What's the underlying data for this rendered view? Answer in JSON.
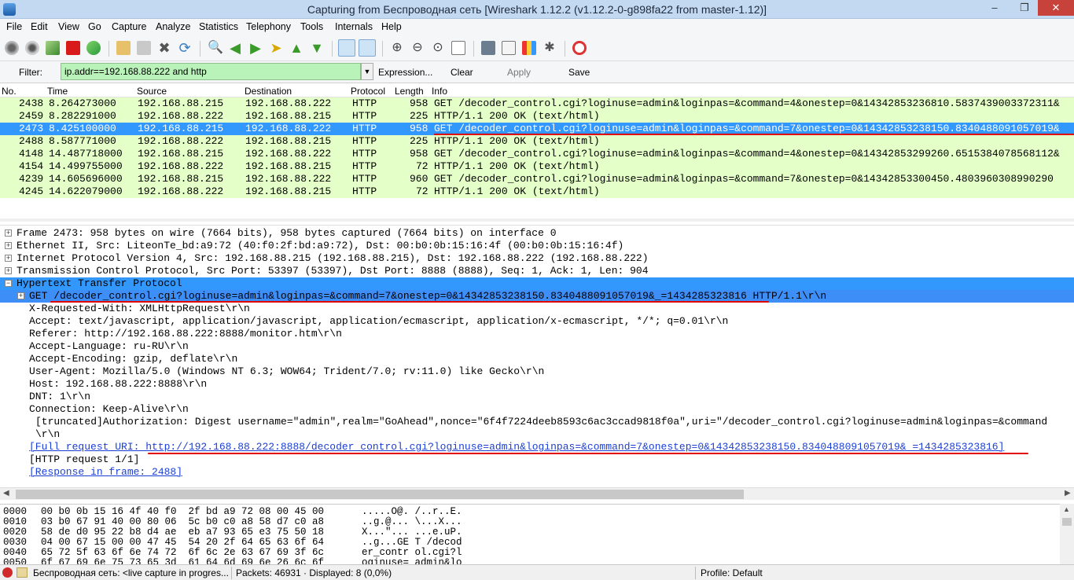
{
  "window": {
    "title": "Capturing from Беспроводная сеть    [Wireshark 1.12.2  (v1.12.2-0-g898fa22 from master-1.12)]"
  },
  "menu": [
    "File",
    "Edit",
    "View",
    "Go",
    "Capture",
    "Analyze",
    "Statistics",
    "Telephony",
    "Tools",
    "Internals",
    "Help"
  ],
  "toolbar": {
    "icons": [
      "interface-list-icon",
      "capture-options-icon",
      "start-capture-icon",
      "stop-capture-icon",
      "restart-capture-icon",
      "open-file-icon",
      "save-file-icon",
      "close-file-icon",
      "reload-icon",
      "find-packet-icon",
      "go-back-icon",
      "go-forward-icon",
      "go-to-packet-icon",
      "go-first-icon",
      "go-last-icon",
      "colorize-icon",
      "auto-scroll-icon",
      "zoom-in-icon",
      "zoom-out-icon",
      "normal-size-icon",
      "resize-columns-icon",
      "capture-filters-icon",
      "display-filters-icon",
      "coloring-rules-icon",
      "preferences-icon",
      "help-icon"
    ]
  },
  "filter": {
    "label": "Filter:",
    "value": "ip.addr==192.168.88.222 and http",
    "expression": "Expression...",
    "clear": "Clear",
    "apply": "Apply",
    "save": "Save",
    "color": "#b9f3b9"
  },
  "packet_list": {
    "columns": [
      "No.",
      "Time",
      "Source",
      "Destination",
      "Protocol",
      "Length",
      "Info"
    ],
    "rows": [
      {
        "no": "2438",
        "time": "8.264273000",
        "src": "192.168.88.215",
        "dst": "192.168.88.222",
        "proto": "HTTP",
        "len": "958",
        "info": "GET /decoder_control.cgi?loginuse=admin&loginpas=&command=4&onestep=0&14342853236810.5837439003372311&"
      },
      {
        "no": "2459",
        "time": "8.282291000",
        "src": "192.168.88.222",
        "dst": "192.168.88.215",
        "proto": "HTTP",
        "len": "225",
        "info": "HTTP/1.1 200 OK  (text/html)"
      },
      {
        "no": "2473",
        "time": "8.425100000",
        "src": "192.168.88.215",
        "dst": "192.168.88.222",
        "proto": "HTTP",
        "len": "958",
        "info": "GET /decoder_control.cgi?loginuse=admin&loginpas=&command=7&onestep=0&14342853238150.8340488091057019&"
      },
      {
        "no": "2488",
        "time": "8.587771000",
        "src": "192.168.88.222",
        "dst": "192.168.88.215",
        "proto": "HTTP",
        "len": "225",
        "info": "HTTP/1.1 200 OK  (text/html)"
      },
      {
        "no": "4148",
        "time": "14.487718000",
        "src": "192.168.88.215",
        "dst": "192.168.88.222",
        "proto": "HTTP",
        "len": "958",
        "info": "GET /decoder_control.cgi?loginuse=admin&loginpas=&command=4&onestep=0&14342853299260.6515384078568112&"
      },
      {
        "no": "4154",
        "time": "14.499755000",
        "src": "192.168.88.222",
        "dst": "192.168.88.215",
        "proto": "HTTP",
        "len": "72",
        "info": "HTTP/1.1 200 OK  (text/html)"
      },
      {
        "no": "4239",
        "time": "14.605696000",
        "src": "192.168.88.215",
        "dst": "192.168.88.222",
        "proto": "HTTP",
        "len": "960",
        "info": "GET /decoder_control.cgi?loginuse=admin&loginpas=&command=7&onestep=0&14342853300450.4803960308990290"
      },
      {
        "no": "4245",
        "time": "14.622079000",
        "src": "192.168.88.222",
        "dst": "192.168.88.215",
        "proto": "HTTP",
        "len": "72",
        "info": "HTTP/1.1 200 OK  (text/html)"
      }
    ]
  },
  "details": {
    "frame": "Frame 2473: 958 bytes on wire (7664 bits), 958 bytes captured (7664 bits) on interface 0",
    "ethernet": "Ethernet II, Src: LiteonTe_bd:a9:72 (40:f0:2f:bd:a9:72), Dst: 00:b0:0b:15:16:4f (00:b0:0b:15:16:4f)",
    "ip": "Internet Protocol Version 4, Src: 192.168.88.215 (192.168.88.215), Dst: 192.168.88.222 (192.168.88.222)",
    "tcp": "Transmission Control Protocol, Src Port: 53397 (53397), Dst Port: 8888 (8888), Seq: 1, Ack: 1, Len: 904",
    "http": "Hypertext Transfer Protocol",
    "get_line": "GET /decoder_control.cgi?loginuse=admin&loginpas=&command=7&onestep=0&14342853238150.8340488091057019&_=1434285323816 HTTP/1.1\\r\\n",
    "headers": [
      "X-Requested-With: XMLHttpRequest\\r\\n",
      "Accept: text/javascript, application/javascript, application/ecmascript, application/x-ecmascript, */*; q=0.01\\r\\n",
      "Referer: http://192.168.88.222:8888/monitor.htm\\r\\n",
      "Accept-Language: ru-RU\\r\\n",
      "Accept-Encoding: gzip, deflate\\r\\n",
      "User-Agent: Mozilla/5.0 (Windows NT 6.3; WOW64; Trident/7.0; rv:11.0) like Gecko\\r\\n",
      "Host: 192.168.88.222:8888\\r\\n",
      "DNT: 1\\r\\n",
      "Connection: Keep-Alive\\r\\n"
    ],
    "auth": "[truncated]Authorization: Digest username=\"admin\",realm=\"GoAhead\",nonce=\"6f4f7224deeb8593c6ac3ccad9818f0a\",uri=\"/decoder_control.cgi?loginuse=admin&loginpas=&command",
    "crlf": "\\r\\n",
    "full_uri": "[Full request URI: http://192.168.88.222:8888/decoder_control.cgi?loginuse=admin&loginpas=&command=7&onestep=0&14342853238150.8340488091057019&_=1434285323816]",
    "request_num": "[HTTP request 1/1]",
    "response_in": "[Response in frame: 2488]"
  },
  "hex": [
    {
      "off": "0000",
      "bytes": "00 b0 0b 15 16 4f 40 f0  2f bd a9 72 08 00 45 00",
      "ascii": ".....O@. /..r..E."
    },
    {
      "off": "0010",
      "bytes": "03 b0 67 91 40 00 80 06  5c b0 c0 a8 58 d7 c0 a8",
      "ascii": "..g.@... \\...X..."
    },
    {
      "off": "0020",
      "bytes": "58 de d0 95 22 b8 d4 ae  eb a7 93 65 e3 75 50 18",
      "ascii": "X...\"... ...e.uP."
    },
    {
      "off": "0030",
      "bytes": "04 00 67 15 00 00 47 45  54 20 2f 64 65 63 6f 64",
      "ascii": "..g...GE T /decod"
    },
    {
      "off": "0040",
      "bytes": "65 72 5f 63 6f 6e 74 72  6f 6c 2e 63 67 69 3f 6c",
      "ascii": "er_contr ol.cgi?l"
    },
    {
      "off": "0050",
      "bytes": "6f 67 69 6e 75 73 65 3d  61 64 6d 69 6e 26 6c 6f",
      "ascii": "oginuse= admin&lo"
    }
  ],
  "status": {
    "capture": "Беспроводная сеть: <live capture in progres...",
    "packets": "Packets: 46931 · Displayed: 8 (0,0%)",
    "profile": "Profile: Default"
  },
  "colors": {
    "selected_row": "#3398fd",
    "http_row": "#e4ffc7",
    "annotation_red": "#e00000",
    "link_blue": "#1a3fd6"
  }
}
